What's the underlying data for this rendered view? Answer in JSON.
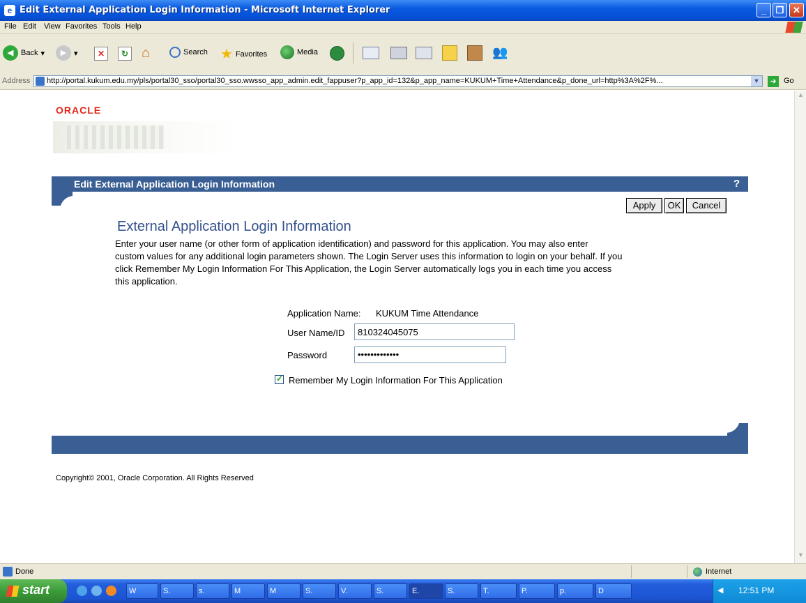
{
  "window": {
    "title": "Edit External Application Login Information - Microsoft Internet Explorer"
  },
  "menu": [
    "File",
    "Edit",
    "View",
    "Favorites",
    "Tools",
    "Help"
  ],
  "toolbar": {
    "back": "Back",
    "search": "Search",
    "favorites": "Favorites",
    "media": "Media"
  },
  "address": {
    "label": "Address",
    "url": "http://portal.kukum.edu.my/pls/portal30_sso/portal30_sso.wwsso_app_admin.edit_fappuser?p_app_id=132&p_app_name=KUKUM+Time+Attendance&p_done_url=http%3A%2F%...",
    "go": "Go"
  },
  "page": {
    "logo": "ORACLE",
    "banner_title": "Edit External Application Login Information",
    "help": "?",
    "buttons": {
      "apply": "Apply",
      "ok": "OK",
      "cancel": "Cancel"
    },
    "heading": "External Application Login Information",
    "intro_lines": [
      "Enter your user name (or other form of application identification) and password for this application. You may also enter",
      "custom values for any additional login parameters shown. The Login Server uses this information to login on your behalf. If you",
      "click Remember My Login Information For This Application, the Login Server automatically logs you in each time you access",
      "this application."
    ],
    "app_name_label": "Application Name:",
    "app_name_value": "KUKUM Time Attendance",
    "username_label": "User Name/ID",
    "username_value": "810324045075",
    "password_label": "Password",
    "password_value": "•••••••••••••",
    "remember_label": "Remember My Login Information For This Application",
    "remember_checked": true,
    "copyright": "Copyright© 2001, Oracle Corporation. All Rights Reserved"
  },
  "status": {
    "text": "Done",
    "zone": "Internet"
  },
  "taskbar": {
    "start": "start",
    "tasks": [
      "W",
      "S.",
      "s.",
      "M",
      "M",
      "S.",
      "V.",
      "S.",
      "E.",
      "S.",
      "T.",
      "P.",
      "p.",
      "D"
    ],
    "clock": "12:51 PM"
  },
  "colors": {
    "banner": "#3a5f94",
    "title_bar": "#0a5ae0",
    "taskbar": "#245edb",
    "start": "#3c9c3a"
  }
}
